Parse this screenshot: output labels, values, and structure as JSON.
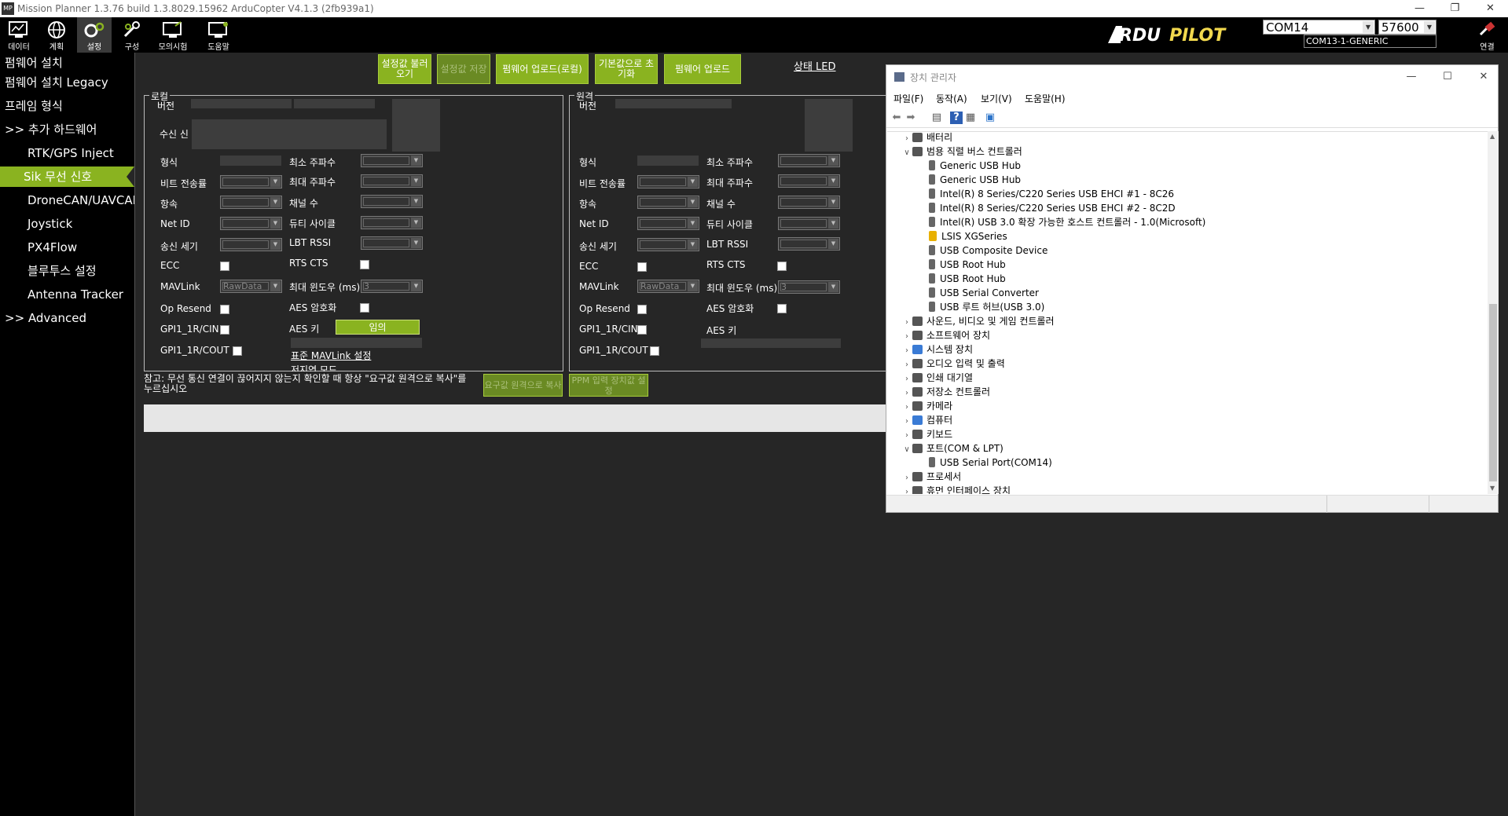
{
  "titlebar": {
    "title": "Mission Planner 1.3.76 build 1.3.8029.15962 ArduCopter V4.1.3 (2fb939a1)",
    "minimize": "—",
    "restore": "❐",
    "close": "✕"
  },
  "toolbar": {
    "items": [
      {
        "label": "데이터",
        "icon": "monitor-icon"
      },
      {
        "label": "계획",
        "icon": "globe-icon"
      },
      {
        "label": "설정",
        "icon": "gears-icon"
      },
      {
        "label": "구성",
        "icon": "wrench-icon"
      },
      {
        "label": "모의시험",
        "icon": "simulation-icon"
      },
      {
        "label": "도움말",
        "icon": "help-monitor-icon"
      }
    ],
    "logo_text": "ARDUPILOT",
    "com_port": "COM14",
    "baud": "57600",
    "com_sub": "COM13-1-GENERIC",
    "connect_label": "연결"
  },
  "sidebar": {
    "items": [
      {
        "label": "펌웨어 설치"
      },
      {
        "label": "펌웨어 설치 Legacy"
      },
      {
        "label": "프레임 형식"
      },
      {
        "label": ">> 추가 하드웨어"
      },
      {
        "label": "RTK/GPS Inject"
      },
      {
        "label": "Sik 무선 신호"
      },
      {
        "label": "DroneCAN/UAVCAN"
      },
      {
        "label": "Joystick"
      },
      {
        "label": "PX4Flow"
      },
      {
        "label": "블루투스 설정"
      },
      {
        "label": "Antenna Tracker"
      },
      {
        "label": ">> Advanced"
      }
    ]
  },
  "buttons": {
    "load_settings": "설정값 불러오기",
    "save_settings": "설정값 저장",
    "upload_firmware_local": "펌웨어 업로드(로컬)",
    "reset_defaults": "기본값으로 초기화",
    "upload_firmware": "펌웨어 업로드",
    "status_led": "상태 LED",
    "copy_required": "요구값 원격으로 복사",
    "ppm_settings": "PPM 입력 장치값 설정"
  },
  "local": {
    "group_title": "로컬",
    "version": "버전",
    "rssi": "수신 신",
    "format": "형식",
    "baud": "비트 전송률",
    "airspeed": "항속",
    "netid": "Net ID",
    "txpower": "송신 세기",
    "ecc": "ECC",
    "mavlink": "MAVLink",
    "mavlink_value": "RawData",
    "op_resend": "Op Resend",
    "gpio_cin": "GPI1_1R/CIN",
    "gpio_cout": "GPI1_1R/COUT",
    "min_freq": "최소 주파수",
    "max_freq": "최대 주파수",
    "channels": "채널 수",
    "duty_cycle": "듀티 사이클",
    "lbt_rssi": "LBT RSSI",
    "rts_cts": "RTS CTS",
    "max_window": "최대 윈도우 (ms)",
    "max_window_value": "3",
    "aes_enc": "AES 암호화",
    "aes_key": "AES 키",
    "aes_random": "임의",
    "std_mavlink": "표준 MAVLink 설정",
    "low_latency": "저지연 모드"
  },
  "remote": {
    "group_title": "원격",
    "version": "버전",
    "format": "형식",
    "baud": "비트 전송률",
    "airspeed": "항속",
    "netid": "Net ID",
    "txpower": "송신 세기",
    "ecc": "ECC",
    "mavlink": "MAVLink",
    "mavlink_value": "RawData",
    "op_resend": "Op Resend",
    "gpio_cin": "GPI1_1R/CIN",
    "gpio_cout": "GPI1_1R/COUT",
    "min_freq": "최소 주파수",
    "max_freq": "최대 주파수",
    "channels": "채널 수",
    "duty_cycle": "듀티 사이클",
    "lbt_rssi": "LBT RSSI",
    "rts_cts": "RTS CTS",
    "max_window": "최대 윈도우 (ms)",
    "max_window_value": "3",
    "aes_enc": "AES 암호화",
    "aes_key": "AES 키"
  },
  "note": "참고: 무선 통신 연결이 끊어지지 않는지 확인할 때 항상 \"요구값 원격으로 복사\"를 누르십시오",
  "devmgr": {
    "title": "장치 관리자",
    "menu": [
      "파일(F)",
      "동작(A)",
      "보기(V)",
      "도움말(H)"
    ],
    "tree": [
      {
        "label": "배터리",
        "level": 0,
        "expanded": false,
        "icon": "battery-icon"
      },
      {
        "label": "범용 직렬 버스 컨트롤러",
        "level": 0,
        "expanded": true,
        "icon": "usb-icon"
      },
      {
        "label": "Generic USB Hub",
        "level": 1,
        "icon": "usb-device-icon"
      },
      {
        "label": "Generic USB Hub",
        "level": 1,
        "icon": "usb-device-icon"
      },
      {
        "label": "Intel(R) 8 Series/C220 Series USB EHCI #1 - 8C26",
        "level": 1,
        "icon": "usb-device-icon"
      },
      {
        "label": "Intel(R) 8 Series/C220 Series USB EHCI #2 - 8C2D",
        "level": 1,
        "icon": "usb-device-icon"
      },
      {
        "label": "Intel(R) USB 3.0 확장 가능한 호스트 컨트롤러 - 1.0(Microsoft)",
        "level": 1,
        "icon": "usb-device-icon"
      },
      {
        "label": "LSIS XGSeries",
        "level": 1,
        "icon": "warning-icon"
      },
      {
        "label": "USB Composite Device",
        "level": 1,
        "icon": "usb-device-icon"
      },
      {
        "label": "USB Root Hub",
        "level": 1,
        "icon": "usb-device-icon"
      },
      {
        "label": "USB Root Hub",
        "level": 1,
        "icon": "usb-device-icon"
      },
      {
        "label": "USB Serial Converter",
        "level": 1,
        "icon": "usb-device-icon"
      },
      {
        "label": "USB 루트 허브(USB 3.0)",
        "level": 1,
        "icon": "usb-device-icon"
      },
      {
        "label": "사운드, 비디오 및 게임 컨트롤러",
        "level": 0,
        "expanded": false,
        "icon": "speaker-icon"
      },
      {
        "label": "소프트웨어 장치",
        "level": 0,
        "expanded": false,
        "icon": "software-icon"
      },
      {
        "label": "시스템 장치",
        "level": 0,
        "expanded": false,
        "icon": "folder-icon"
      },
      {
        "label": "오디오 입력 및 출력",
        "level": 0,
        "expanded": false,
        "icon": "audio-icon"
      },
      {
        "label": "인쇄 대기열",
        "level": 0,
        "expanded": false,
        "icon": "printer-icon"
      },
      {
        "label": "저장소 컨트롤러",
        "level": 0,
        "expanded": false,
        "icon": "storage-icon"
      },
      {
        "label": "카메라",
        "level": 0,
        "expanded": false,
        "icon": "camera-icon"
      },
      {
        "label": "컴퓨터",
        "level": 0,
        "expanded": false,
        "icon": "computer-icon"
      },
      {
        "label": "키보드",
        "level": 0,
        "expanded": false,
        "icon": "keyboard-icon"
      },
      {
        "label": "포트(COM & LPT)",
        "level": 0,
        "expanded": true,
        "icon": "port-icon"
      },
      {
        "label": "USB Serial Port(COM14)",
        "level": 1,
        "icon": "port-device-icon"
      },
      {
        "label": "프로세서",
        "level": 0,
        "expanded": false,
        "icon": "processor-icon"
      },
      {
        "label": "휴먼 인터페이스 장치",
        "level": 0,
        "expanded": false,
        "icon": "hid-icon"
      }
    ]
  }
}
